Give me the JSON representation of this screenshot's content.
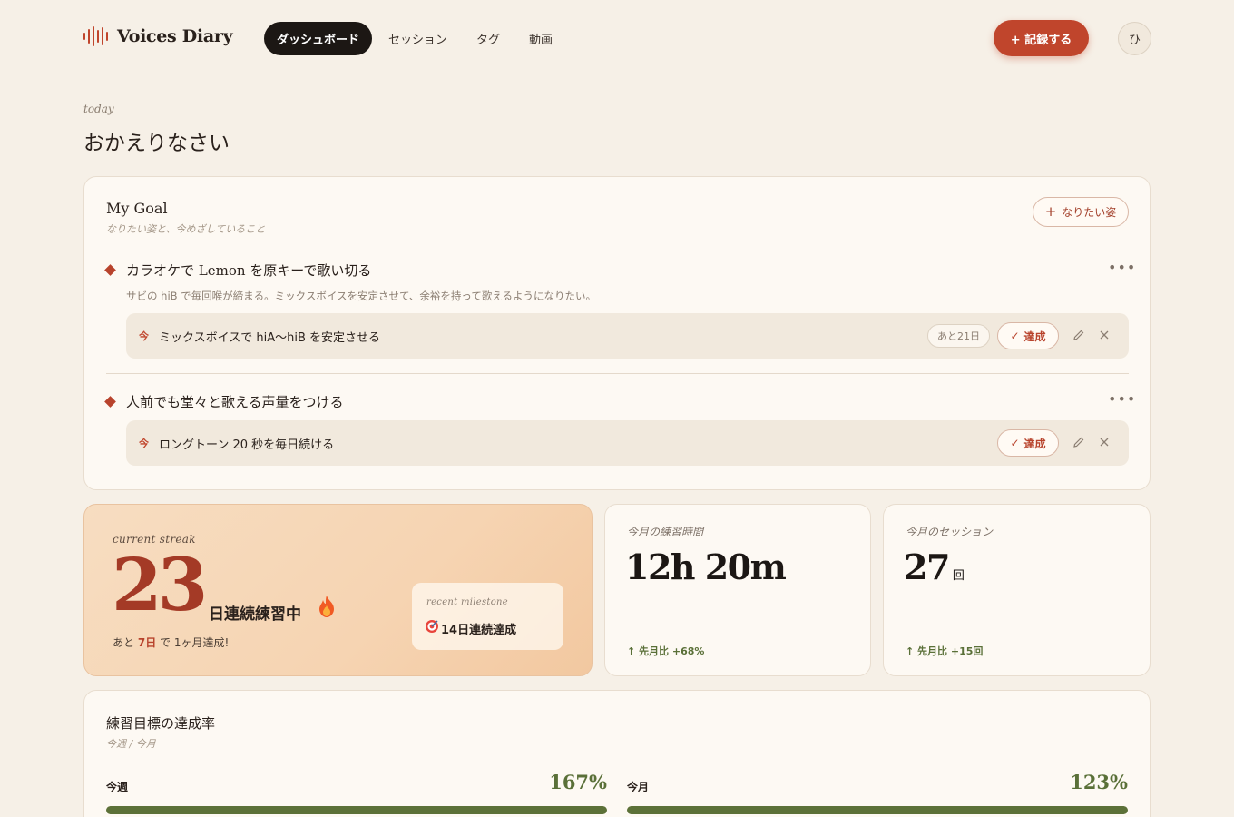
{
  "app": {
    "name": "Voices Diary"
  },
  "nav": [
    "ダッシュボード",
    "セッション",
    "タグ",
    "動画"
  ],
  "header": {
    "record_label": "+ 記録する",
    "avatar": "ひ"
  },
  "greeting": {
    "kicker": "today",
    "title": "おかえりなさい"
  },
  "goal_card": {
    "title": "My Goal",
    "subtitle": "なりたい姿と、今めざしていること",
    "add_label": "なりたい姿",
    "goals": [
      {
        "title": "カラオケで Lemon を原キーで歌い切る",
        "description": "サビの hiB で毎回喉が締まる。ミックスボイスを安定させて、余裕を持って歌えるようになりたい。",
        "subgoal": {
          "tag": "今",
          "text": "ミックスボイスで hiA〜hiB を安定させる",
          "remaining": "あと21日",
          "done_label": "達成"
        }
      },
      {
        "title": "人前でも堂々と歌える声量をつける",
        "subgoal": {
          "tag": "今",
          "text": "ロングトーン 20 秒を毎日続ける",
          "done_label": "達成"
        }
      }
    ]
  },
  "streak": {
    "label": "current streak",
    "count": "23",
    "unit": "日連続練習中",
    "note_prefix": "あと",
    "note_days": "7日",
    "note_suffix": "で 1ヶ月達成!",
    "milestone_label": "recent milestone",
    "milestone_text": "14日連続達成"
  },
  "stats": [
    {
      "label": "今月の練習時間",
      "value": "12h 20m",
      "unit": "",
      "delta": "先月比 +68%"
    },
    {
      "label": "今月のセッション",
      "value": "27",
      "unit": "回",
      "delta": "先月比 +15回"
    }
  ],
  "rates": {
    "title": "練習目標の達成率",
    "subtitle": "今週 / 今月",
    "items": [
      {
        "name": "今週",
        "pct": "167%",
        "fill": 1.0
      },
      {
        "name": "今月",
        "pct": "123%",
        "fill": 1.0
      }
    ]
  },
  "colors": {
    "accent": "#c0452c",
    "success": "#5a7038",
    "background": "#f6f0e7"
  }
}
